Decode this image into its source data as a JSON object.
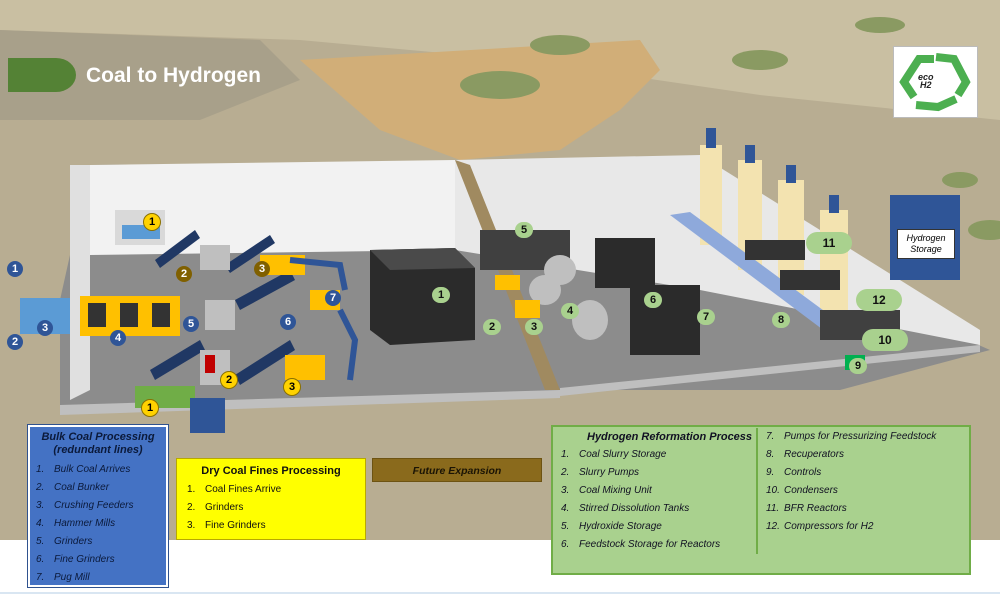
{
  "title": "Coal to Hydrogen",
  "logo": {
    "line1": "eco",
    "line2": "H2"
  },
  "colors": {
    "bulk": "#4472c4",
    "dry": "#ffff00",
    "future": "#8a6a1c",
    "hydrogen": "#a9d18e",
    "title_tab": "#548235"
  },
  "bulk_legend": {
    "title": "Bulk Coal Processing (redundant lines)",
    "items": [
      {
        "num": "1.",
        "label": "Bulk Coal Arrives"
      },
      {
        "num": "2.",
        "label": "Coal Bunker"
      },
      {
        "num": "3.",
        "label": "Crushing Feeders"
      },
      {
        "num": "4.",
        "label": "Hammer Mills"
      },
      {
        "num": "5.",
        "label": "Grinders"
      },
      {
        "num": "6.",
        "label": "Fine Grinders"
      },
      {
        "num": "7.",
        "label": "Pug Mill"
      }
    ]
  },
  "dry_legend": {
    "title": "Dry Coal Fines Processing",
    "items": [
      {
        "num": "1.",
        "label": "Coal Fines Arrive"
      },
      {
        "num": "2.",
        "label": "Grinders"
      },
      {
        "num": "3.",
        "label": "Fine Grinders"
      }
    ]
  },
  "future_label": "Future Expansion",
  "hydrogen_legend": {
    "title": "Hydrogen Reformation Process",
    "col1": [
      {
        "num": "1.",
        "label": "Coal Slurry Storage"
      },
      {
        "num": "2.",
        "label": "Slurry Pumps"
      },
      {
        "num": "3.",
        "label": "Coal Mixing Unit"
      },
      {
        "num": "4.",
        "label": "Stirred Dissolution Tanks"
      },
      {
        "num": "5.",
        "label": "Hydroxide Storage"
      },
      {
        "num": "6.",
        "label": "Feedstock Storage for Reactors"
      }
    ],
    "col2": [
      {
        "num": "7.",
        "label": "Pumps for Pressurizing Feedstock"
      },
      {
        "num": "8.",
        "label": "Recuperators"
      },
      {
        "num": "9.",
        "label": "Controls"
      },
      {
        "num": "10.",
        "label": "Condensers"
      },
      {
        "num": "11.",
        "label": "BFR Reactors"
      },
      {
        "num": "12.",
        "label": "Compressors for H2"
      }
    ]
  },
  "h2_storage_label": "Hydrogen Storage",
  "markers": {
    "blue": [
      "1",
      "2",
      "3",
      "4",
      "5",
      "6",
      "7"
    ],
    "yellow": [
      "1",
      "2",
      "3",
      "1",
      "2",
      "3"
    ],
    "brown": [
      "1",
      "2",
      "3"
    ],
    "green": [
      "1",
      "2",
      "3",
      "4",
      "5",
      "6",
      "7",
      "8",
      "9"
    ],
    "green_large": [
      "11",
      "12",
      "10"
    ]
  }
}
